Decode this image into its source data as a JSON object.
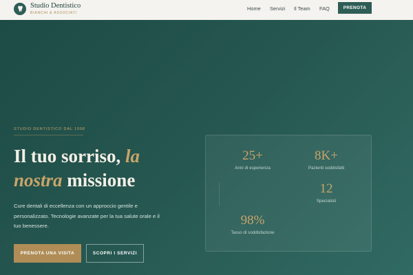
{
  "brand": {
    "name": "Studio Dentistico",
    "subtitle": "BIANCHI & ASSOCIATI"
  },
  "nav": {
    "links": [
      "Home",
      "Servizi",
      "Il Team",
      "FAQ"
    ],
    "cta": "PRENOTA"
  },
  "hero": {
    "eyebrow": "STUDIO DENTISTICO DAL 1998",
    "headline": {
      "part1": "Il tuo sorriso,",
      "accent1": "la",
      "accent2": "nostra",
      "part2": "missione"
    },
    "description": "Cure dentali di eccellenza con un approccio gentile e personalizzato. Tecnologie avanzate per la tua salute orale e il tuo benessere.",
    "primary_button": "PRENOTA UNA VISITA",
    "secondary_button": "SCOPRI I SERVIZI"
  },
  "stats": [
    {
      "value": "25+",
      "label": "Anni di esperienza"
    },
    {
      "value": "8K+",
      "label": "Pazienti soddisfatti"
    },
    {
      "value": "12",
      "label": "Specialisti"
    },
    {
      "value": "98%",
      "label": "Tasso di soddisfazione"
    }
  ],
  "colors": {
    "accent": "#b08d57",
    "brand_green": "#2e5d56",
    "nav_background": "#f4f3ef"
  },
  "icons": {
    "logo": "tooth-icon"
  }
}
